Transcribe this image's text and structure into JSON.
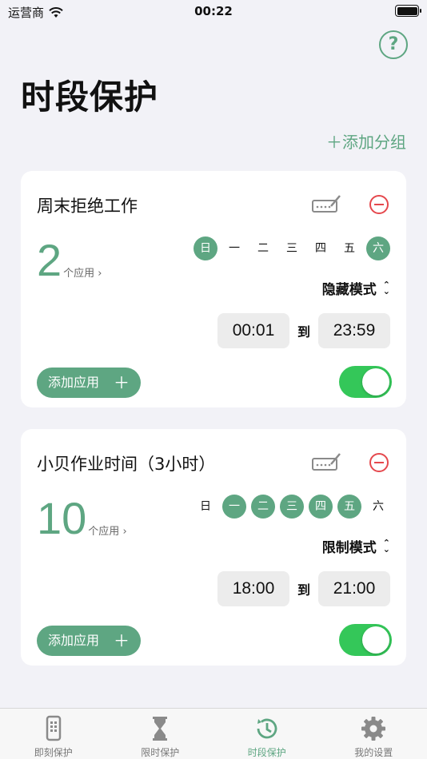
{
  "status": {
    "carrier": "运营商",
    "time": "00:22"
  },
  "header": {
    "title": "时段保护",
    "help_label": "?",
    "add_group": "＋添加分组"
  },
  "groups": [
    {
      "title": "周末拒绝工作",
      "app_count": "2",
      "app_unit": "个应用",
      "days": [
        {
          "label": "日",
          "active": true
        },
        {
          "label": "一",
          "active": false
        },
        {
          "label": "二",
          "active": false
        },
        {
          "label": "三",
          "active": false
        },
        {
          "label": "四",
          "active": false
        },
        {
          "label": "五",
          "active": false
        },
        {
          "label": "六",
          "active": true
        }
      ],
      "mode": "隐藏模式",
      "start": "00:01",
      "to": "到",
      "end": "23:59",
      "add_app": "添加应用",
      "enabled": true
    },
    {
      "title": "小贝作业时间（3小时）",
      "app_count": "10",
      "app_unit": "个应用",
      "days": [
        {
          "label": "日",
          "active": false
        },
        {
          "label": "一",
          "active": true
        },
        {
          "label": "二",
          "active": true
        },
        {
          "label": "三",
          "active": true
        },
        {
          "label": "四",
          "active": true
        },
        {
          "label": "五",
          "active": true
        },
        {
          "label": "六",
          "active": false
        }
      ],
      "mode": "限制模式",
      "start": "18:00",
      "to": "到",
      "end": "21:00",
      "add_app": "添加应用",
      "enabled": true
    }
  ],
  "tabs": [
    {
      "label": "即刻保护",
      "icon": "phone-icon",
      "active": false
    },
    {
      "label": "限时保护",
      "icon": "hourglass-icon",
      "active": false
    },
    {
      "label": "时段保护",
      "icon": "clock-refresh-icon",
      "active": true
    },
    {
      "label": "我的设置",
      "icon": "gear-icon",
      "active": false
    }
  ],
  "colors": {
    "accent": "#5ea682",
    "toggle_on": "#34c759",
    "danger": "#e5484d"
  }
}
